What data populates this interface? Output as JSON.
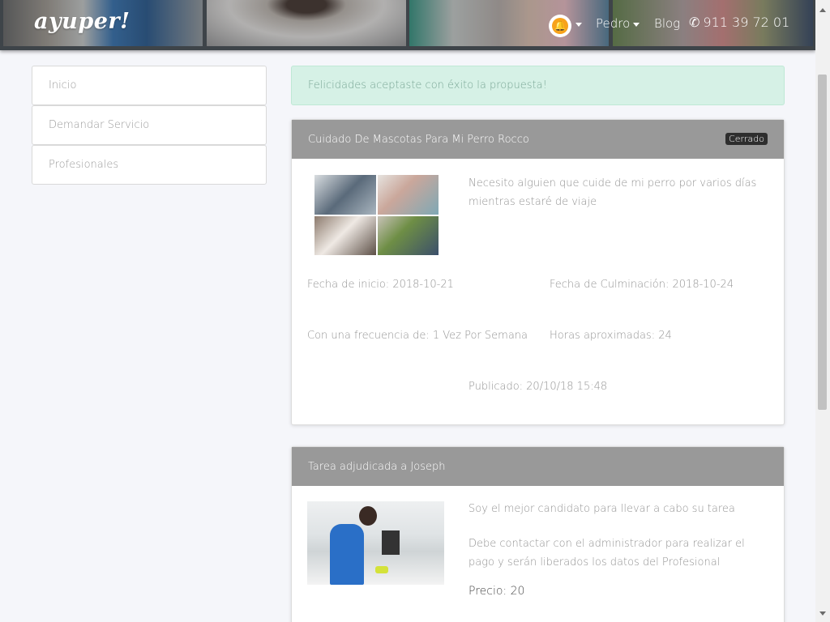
{
  "header": {
    "logo": "ayuper!",
    "bell_icon": "bell-icon",
    "user_name": "Pedro",
    "blog_label": "Blog",
    "phone_icon": "phone-icon",
    "phone": "911 39 72 01"
  },
  "sidebar": {
    "items": [
      {
        "label": "Inicio"
      },
      {
        "label": "Demandar Servicio"
      },
      {
        "label": "Profesionales"
      }
    ]
  },
  "alert": {
    "message": "Felicidades aceptaste con éxito la propuesta!"
  },
  "task": {
    "title": "Cuidado De Mascotas Para Mi Perro Rocco",
    "status": "Cerrado",
    "description": "Necesito alguien que cuide de mi perro por varios días mientras estaré de viaje",
    "start_date": "Fecha de inicio: 2018-10-21",
    "end_date": "Fecha de Culminación: 2018-10-24",
    "frequency": "Con una frecuencia de: 1 Vez Por Semana",
    "hours": "Horas aproximadas: 24",
    "published": "Publicado: 20/10/18 15:48"
  },
  "assignment": {
    "title": "Tarea adjudicada a Joseph",
    "pitch": "Soy el mejor candidato para llevar a cabo su tarea",
    "payment_note": "Debe contactar con el administrador para realizar el pago y serán liberados los datos del Profesional",
    "price": "Precio: 20"
  },
  "colors": {
    "header_panel": "#999999",
    "alert_bg": "#d6f1e6",
    "bell": "#f7a21b",
    "badge_bg": "#2e2e2e"
  }
}
